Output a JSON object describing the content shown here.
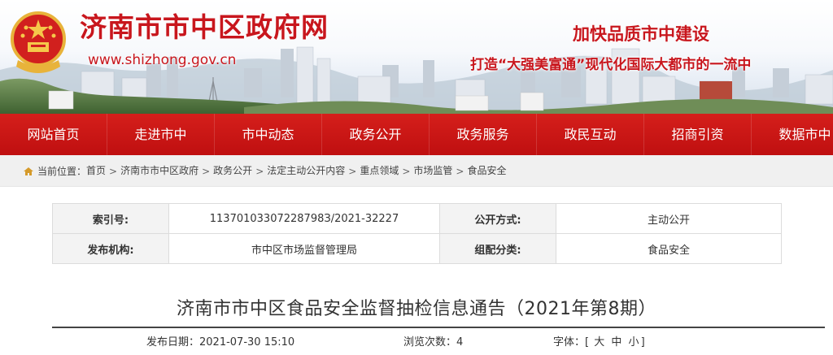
{
  "header": {
    "site_title": "济南市市中区政府网",
    "site_url": "www.shizhong.gov.cn",
    "slogan_line1": "加快品质市中建设",
    "slogan_line2": "打造“大强美富通”现代化国际大都市的一流中"
  },
  "nav": {
    "items": [
      "网站首页",
      "走进市中",
      "市中动态",
      "政务公开",
      "政务服务",
      "政民互动",
      "招商引资",
      "数据市中"
    ]
  },
  "breadcrumb": {
    "label": "当前位置：",
    "items": [
      "首页",
      "济南市市中区政府",
      "政务公开",
      "法定主动公开内容",
      "重点领域",
      "市场监管",
      "食品安全"
    ],
    "separator": ">"
  },
  "info": {
    "index_label": "索引号:",
    "index_value": "11370103307228798З/2021-32227",
    "disclosure_label": "公开方式:",
    "disclosure_value": "主动公开",
    "publisher_label": "发布机构:",
    "publisher_value": "市中区市场监督管理局",
    "category_label": "组配分类:",
    "category_value": "食品安全"
  },
  "article": {
    "title": "济南市市中区食品安全监督抽检信息通告（2021年第8期）",
    "publish_label": "发布日期：",
    "publish_date": "2021-07-30 15:10",
    "views_label": "浏览次数：",
    "views": "4",
    "font_label": "字体：",
    "font_open": "[",
    "font_large": "大",
    "font_medium": "中",
    "font_small": "小",
    "font_close": "]"
  },
  "colors": {
    "brand_red": "#c8161d",
    "nav_red": "#c91515",
    "breadcrumb_bg": "#f0f0f0"
  },
  "icons": {
    "emblem": "national-emblem",
    "home": "home-icon"
  }
}
